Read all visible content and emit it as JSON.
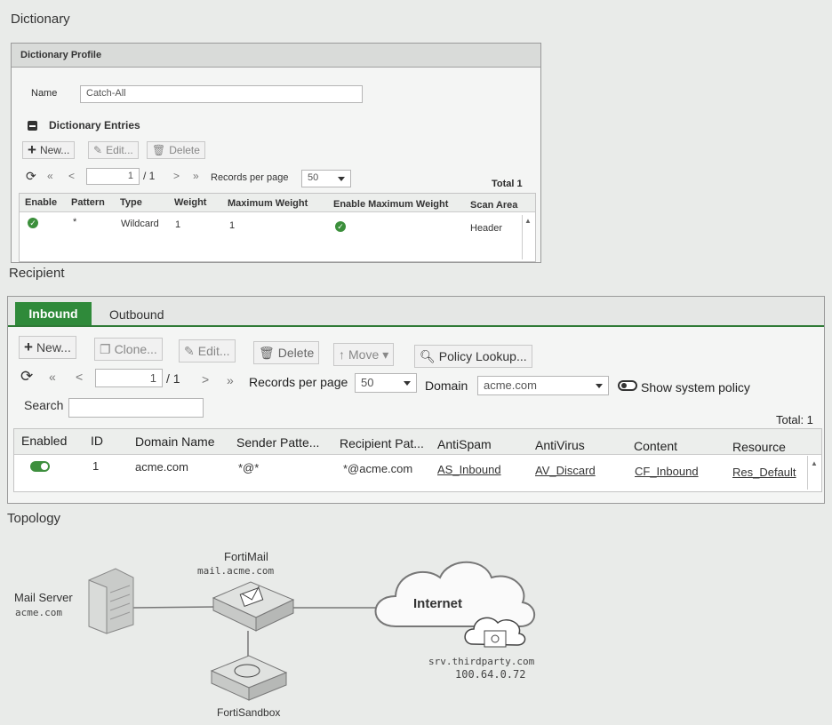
{
  "dictionary": {
    "section_title": "Dictionary",
    "panel_header": "Dictionary Profile",
    "name_label": "Name",
    "name_value": "Catch-All",
    "entries_label": "Dictionary Entries",
    "toolbar": {
      "new": "New...",
      "edit": "Edit...",
      "delete": "Delete"
    },
    "pager": {
      "first": "«",
      "prev": "<",
      "page": "1",
      "of": "/ 1",
      "next": ">",
      "last": "»",
      "records_label": "Records per page",
      "records_value": "50",
      "total": "Total 1"
    },
    "columns": [
      "Enable",
      "Pattern",
      "Type",
      "Weight",
      "Maximum Weight",
      "Enable Maximum Weight",
      "Scan Area"
    ],
    "row": {
      "pattern": "*",
      "type": "Wildcard",
      "weight": "1",
      "max_weight": "1",
      "scan_area": "Header"
    }
  },
  "recipient": {
    "section_title": "Recipient",
    "tabs": [
      "Inbound",
      "Outbound"
    ],
    "toolbar": {
      "new": "New...",
      "clone": "Clone...",
      "edit": "Edit...",
      "delete": "Delete",
      "move": "Move",
      "lookup": "Policy Lookup..."
    },
    "pager": {
      "first": "«",
      "prev": "<",
      "page": "1",
      "of": "/ 1",
      "next": ">",
      "last": "»",
      "records_label": "Records per page",
      "records_value": "50",
      "domain_label": "Domain",
      "domain_value": "acme.com",
      "show_system": "Show system policy",
      "total": "Total: 1"
    },
    "search_label": "Search",
    "columns": [
      "Enabled",
      "ID",
      "Domain Name",
      "Sender Patte...",
      "Recipient Pat...",
      "AntiSpam",
      "AntiVirus",
      "Content",
      "Resource"
    ],
    "row": {
      "id": "1",
      "domain": "acme.com",
      "sender": "*@*",
      "recipient": "*@acme.com",
      "antispam": "AS_Inbound",
      "antivirus": "AV_Discard",
      "content": "CF_Inbound",
      "resource": "Res_Default"
    }
  },
  "topology": {
    "section_title": "Topology",
    "mail_server": "Mail Server",
    "mail_server_domain": "acme.com",
    "fortimail": "FortiMail",
    "fortimail_host": "mail.acme.com",
    "internet": "Internet",
    "third_party_host": "srv.thirdparty.com",
    "third_party_ip": "100.64.0.72",
    "fortisandbox": "FortiSandbox"
  },
  "colors": {
    "accent_green": "#2e7d32",
    "tab_active": "#2f8a3a"
  }
}
